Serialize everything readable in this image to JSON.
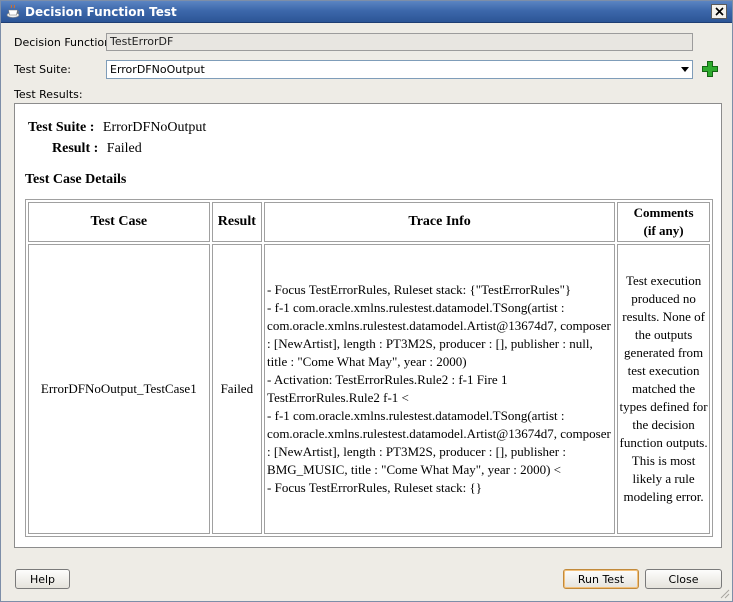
{
  "window": {
    "title": "Decision Function Test"
  },
  "form": {
    "decision_function_label": "Decision Function:",
    "decision_function_value": "TestErrorDF",
    "test_suite_label": "Test Suite:",
    "test_suite_value": "ErrorDFNoOutput",
    "test_results_label": "Test Results:"
  },
  "results": {
    "suite_key": "Test Suite :",
    "suite_value": "ErrorDFNoOutput",
    "result_key": "Result :",
    "result_value": "Failed",
    "details_title": "Test Case Details",
    "headers": {
      "test_case": "Test Case",
      "result": "Result",
      "trace_info": "Trace Info",
      "comments_line1": "Comments",
      "comments_line2": "(if any)"
    },
    "row": {
      "test_case": "ErrorDFNoOutput_TestCase1",
      "result": "Failed",
      "trace_lines": [
        "- Focus TestErrorRules, Ruleset stack: {\"TestErrorRules\"}",
        "- f-1 com.oracle.xmlns.rulestest.datamodel.TSong(artist : com.oracle.xmlns.rulestest.datamodel.Artist@13674d7, composer : [NewArtist], length : PT3M2S, producer : [], publisher : null, title : \"Come What May\", year : 2000)",
        "- Activation: TestErrorRules.Rule2 : f-1 Fire 1 TestErrorRules.Rule2 f-1 <",
        "- f-1 com.oracle.xmlns.rulestest.datamodel.TSong(artist : com.oracle.xmlns.rulestest.datamodel.Artist@13674d7, composer : [NewArtist], length : PT3M2S, producer : [], publisher : BMG_MUSIC, title : \"Come What May\", year : 2000) <",
        "- Focus TestErrorRules, Ruleset stack: {}"
      ],
      "comment": "Test execution produced no results. None of the outputs generated from test execution matched the types defined for the decision function outputs. This is most likely a rule modeling error."
    }
  },
  "buttons": {
    "help": "Help",
    "run_test": "Run Test",
    "close": "Close"
  },
  "icons": {
    "app": "coffee-cup-icon",
    "close": "close-icon",
    "add": "add-icon",
    "dropdown": "chevron-down-icon"
  }
}
